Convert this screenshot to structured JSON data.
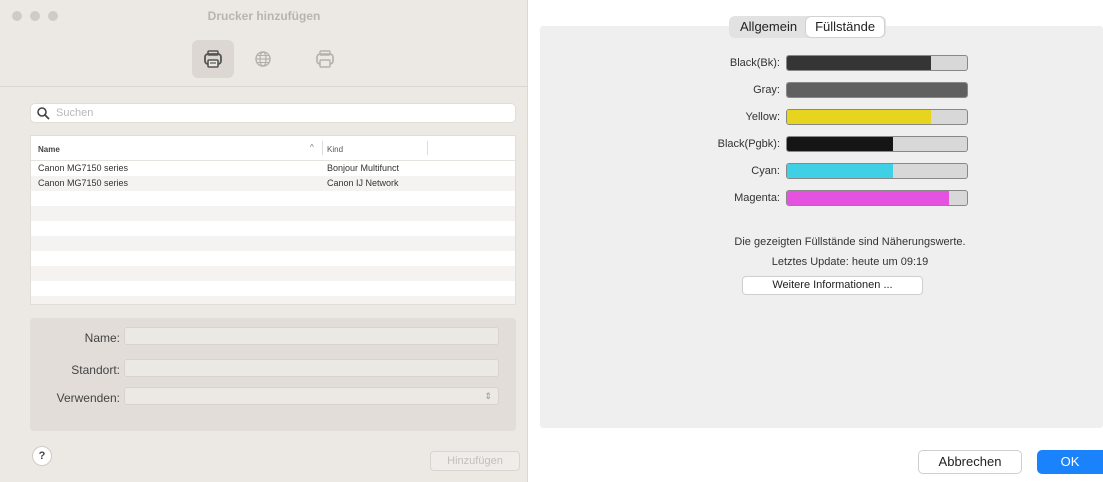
{
  "add_printer_window": {
    "title": "Drucker hinzufügen",
    "toolbar": {
      "items": [
        {
          "icon": "printer-icon",
          "active": true
        },
        {
          "icon": "globe-icon",
          "active": false
        },
        {
          "icon": "printer-outline-icon",
          "active": false
        }
      ]
    },
    "search": {
      "placeholder": "Suchen",
      "value": ""
    },
    "table": {
      "columns": [
        "Name",
        "Kind"
      ],
      "rows": [
        {
          "name": "Canon MG7150 series",
          "kind": "Bonjour Multifunct"
        },
        {
          "name": "Canon MG7150 series",
          "kind": "Canon IJ Network"
        }
      ]
    },
    "details": {
      "name_label": "Name:",
      "name_value": "",
      "location_label": "Standort:",
      "location_value": "",
      "use_label": "Verwenden:",
      "use_value": ""
    },
    "help_label": "?",
    "add_button_label": "Hinzufügen"
  },
  "ink_window": {
    "tabs": [
      {
        "label": "Allgemein",
        "active": false
      },
      {
        "label": "Füllstände",
        "active": true
      }
    ],
    "levels": [
      {
        "label": "Black(Bk):",
        "level": 0.8,
        "color": "#353535"
      },
      {
        "label": "Gray:",
        "level": 1.0,
        "color": "#606060"
      },
      {
        "label": "Yellow:",
        "level": 0.8,
        "color": "#e6d41e"
      },
      {
        "label": "Black(Pgbk):",
        "level": 0.59,
        "color": "#151515"
      },
      {
        "label": "Cyan:",
        "level": 0.59,
        "color": "#3fd0e6"
      },
      {
        "label": "Magenta:",
        "level": 0.9,
        "color": "#e552e0"
      }
    ],
    "note_line1": "Die gezeigten Füllstände sind Näherungswerte.",
    "note_line2": "Letztes Update: heute um 09:19",
    "more_info_label": "Weitere Informationen ...",
    "cancel_label": "Abbrechen",
    "ok_label": "OK",
    "accent_color": "#1a82fb"
  }
}
